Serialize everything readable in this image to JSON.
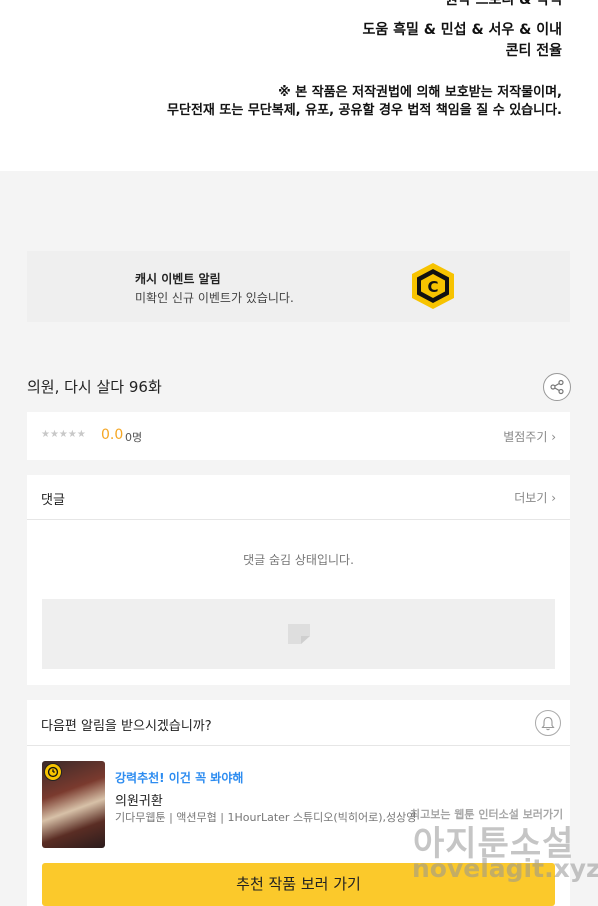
{
  "credits": {
    "line0": "원작 스토리 & 각색",
    "line1": "도움 흑밀 & 민섭 & 서우 & 이내",
    "line2": "콘티 전율"
  },
  "copyright": {
    "line1": "※ 본 작품은 저작권법에 의해 보호받는 저작물이며,",
    "line2": "무단전재 또는 무단복제, 유포, 공유할 경우 법적 책임을 질 수 있습니다."
  },
  "banner": {
    "title": "캐시 이벤트 알림",
    "subtitle": "미확인 신규 이벤트가 있습니다.",
    "coin_icon": "cash-coin-icon",
    "coin_color": "#f7c300"
  },
  "episode": {
    "title": "의원, 다시 살다 96화"
  },
  "rating": {
    "stars": "★★★★★",
    "score": "0.0",
    "count": "0명",
    "action": "별점주기 ›"
  },
  "comments": {
    "title": "댓글",
    "more": "더보기 ›",
    "hidden_text": "댓글 숨김 상태입니다."
  },
  "next_episode": {
    "question": "다음편 알림을 받으시겠습니까?",
    "promo": "강력추천! 이건 꼭 봐야해",
    "work_title": "의원귀환",
    "meta": "기다무웹툰 | 액션무협 | 1HourLater 스튜디오(빅히어로),성상영",
    "button": "추천 작품 보러 가기"
  },
  "watermark": {
    "top": "최고보는 웹툰 인터소설 보러가기",
    "mid": "아지툰소설",
    "bottom": "novelagit.xyz"
  },
  "colors": {
    "accent": "#fbc92b",
    "link": "#2d8cf0",
    "score": "#f5a623"
  }
}
